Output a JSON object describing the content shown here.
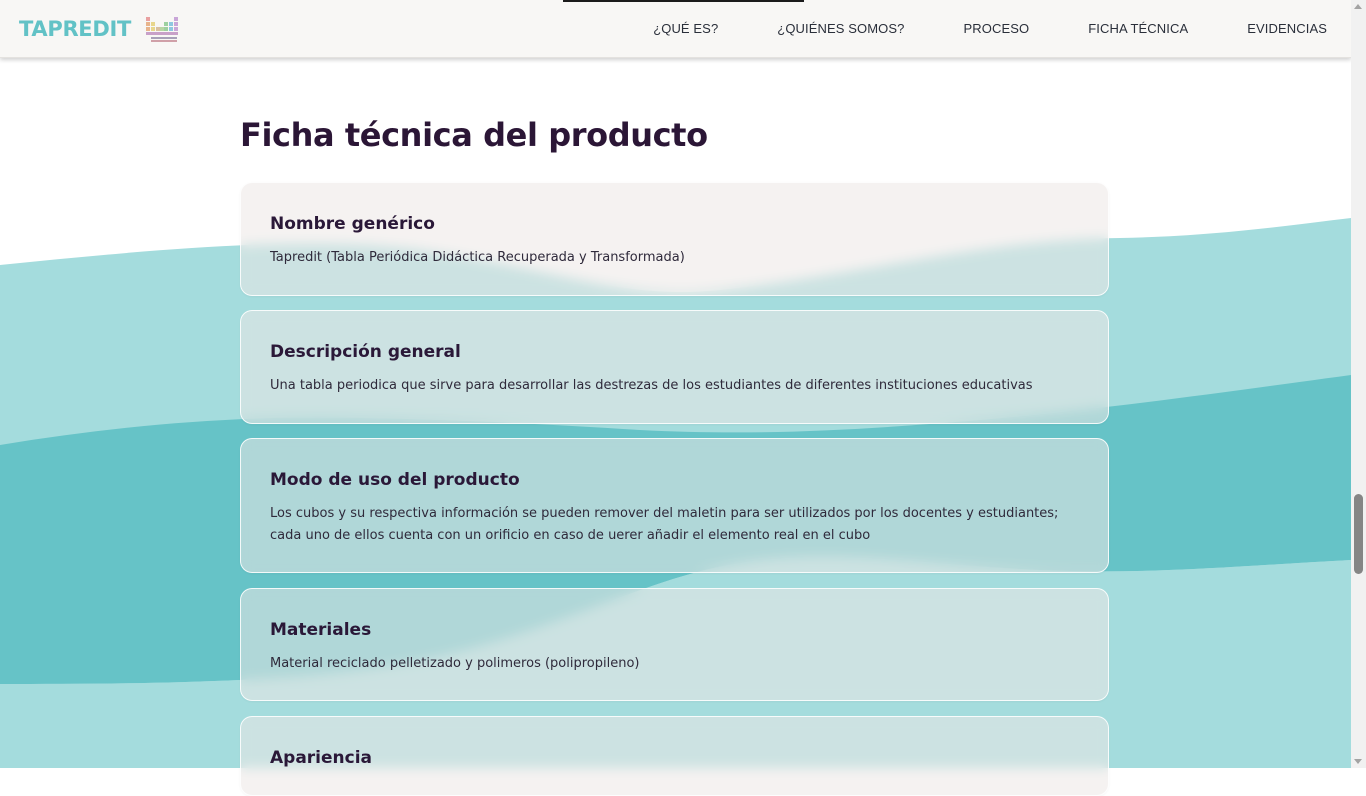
{
  "brand": {
    "name": "TAPREDIT",
    "logo_icon": "periodic-table-icon"
  },
  "nav": {
    "items": [
      {
        "label": "¿QUÉ ES?"
      },
      {
        "label": "¿QUIÉNES SOMOS?"
      },
      {
        "label": "PROCESO"
      },
      {
        "label": "FICHA TÉCNICA"
      },
      {
        "label": "EVIDENCIAS"
      }
    ]
  },
  "page": {
    "title": "Ficha técnica del producto"
  },
  "cards": [
    {
      "title": "Nombre genérico",
      "text": "Tapredit (Tabla Periódica Didáctica Recuperada y Transformada)"
    },
    {
      "title": "Descripción general",
      "text": "Una tabla periodica que sirve para desarrollar las destrezas de los estudiantes de diferentes instituciones educativas"
    },
    {
      "title": "Modo de uso del producto",
      "text": "Los cubos y su respectiva información se pueden remover del maletin para ser utilizados por los docentes y estudiantes; cada uno de ellos cuenta con un orificio en caso de uerer añadir el elemento real en el cubo"
    },
    {
      "title": "Materiales",
      "text": "Material reciclado pelletizado y polimeros (polipropileno)"
    },
    {
      "title": "Apariencia",
      "text": ""
    }
  ],
  "colors": {
    "brand_teal": "#62c2c6",
    "wave_light": "#a4dcdd",
    "wave_dark": "#66c3c7",
    "title_dark": "#2b1636"
  }
}
